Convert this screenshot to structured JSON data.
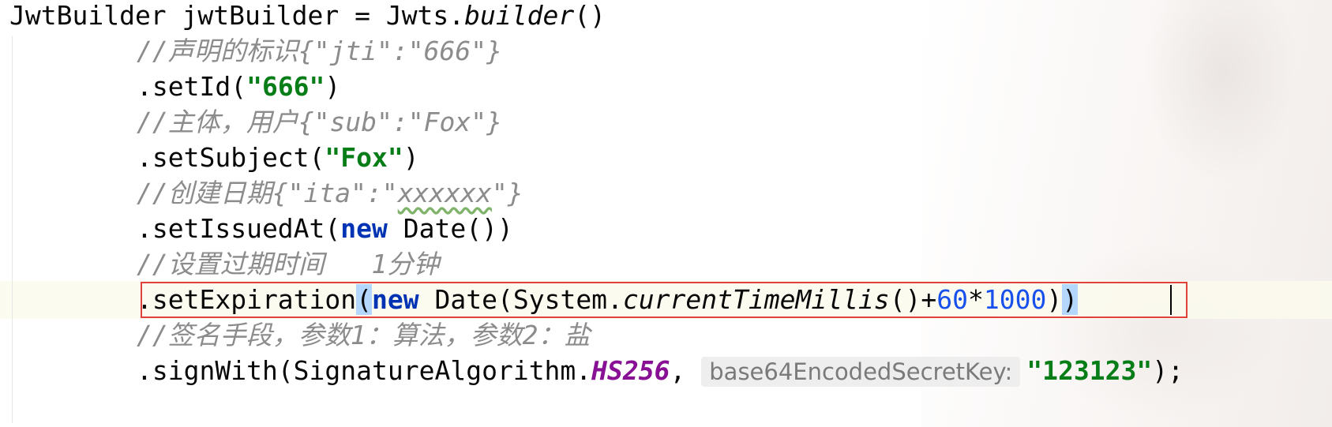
{
  "code": {
    "l1": {
      "decl": "JwtBuilder jwtBuilder = Jwts.",
      "method": "builder",
      "tail": "()"
    },
    "l2": {
      "comment": "//声明的标识{\"jti\":\"666\"}"
    },
    "l3": {
      "call": ".setId(",
      "str": "\"666\"",
      "tail": ")"
    },
    "l4": {
      "comment": "//主体，用户{\"sub\":\"Fox\"}"
    },
    "l5": {
      "call": ".setSubject(",
      "str": "\"Fox\"",
      "tail": ")"
    },
    "l6": {
      "comment_a": "//创建日期{\"ita\":\"",
      "comment_sq": "xxxxxx",
      "comment_b": "\"}"
    },
    "l7": {
      "call": ".setIssuedAt(",
      "kw": "new",
      "rest": " Date())"
    },
    "l8": {
      "comment": "//设置过期时间   1分钟"
    },
    "l9": {
      "call": ".setExpiration",
      "open": "(",
      "kw": "new",
      "mid": " Date(System.",
      "method": "currentTimeMillis",
      "after": "()+",
      "n1": "60",
      "op": "*",
      "n2": "1000",
      "close1": ")",
      "close2": ")"
    },
    "l10": {
      "comment": "//签名手段，参数1：算法，参数2：盐"
    },
    "l11": {
      "call": ".signWith(SignatureAlgorithm.",
      "const": "HS256",
      "comma": ", ",
      "hint": "base64EncodedSecretKey:",
      "str": "\"123123\"",
      "tail": ");"
    }
  },
  "colors": {
    "comment": "#8c8c8c",
    "string": "#067d17",
    "keyword": "#0033b3",
    "number": "#1750eb",
    "constant": "#871094",
    "highlight_box": "#e0413a"
  }
}
